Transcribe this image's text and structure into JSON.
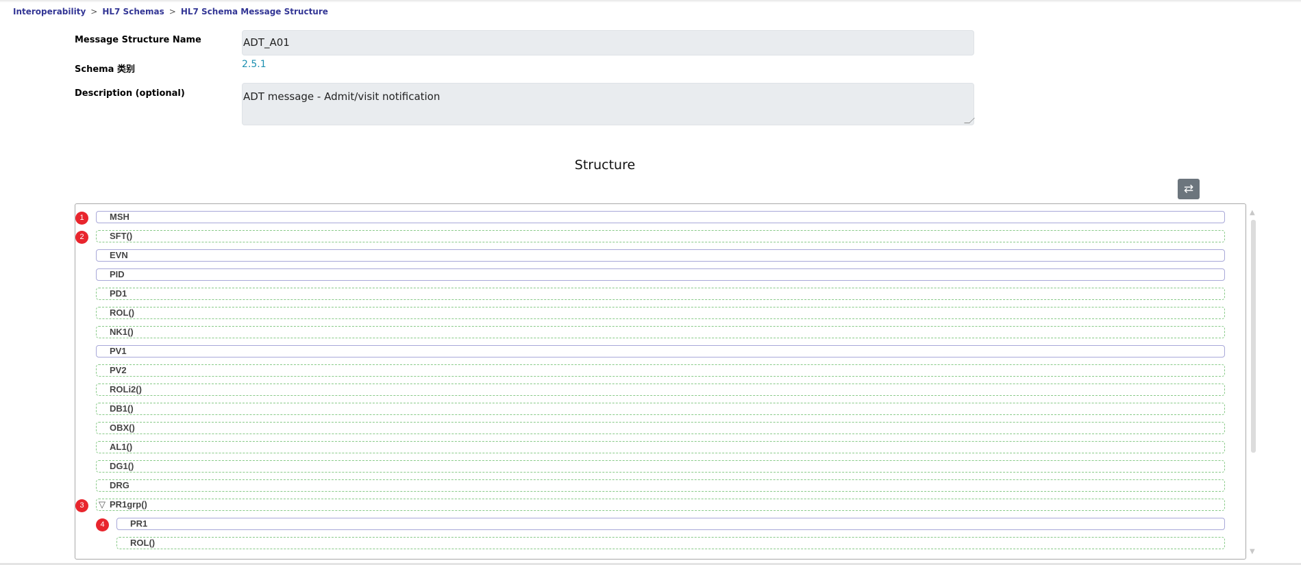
{
  "breadcrumb": {
    "items": [
      "Interoperability",
      "HL7 Schemas",
      "HL7 Schema Message Structure"
    ],
    "separator": ">"
  },
  "form": {
    "name_label": "Message Structure Name",
    "name_value": "ADT_A01",
    "schema_label": "Schema 类别",
    "schema_value": "2.5.1",
    "description_label": "Description (optional)",
    "description_value": "ADT message - Admit/visit notification"
  },
  "structure": {
    "title": "Structure",
    "toggle_icon": "swap-arrows-icon",
    "segments": [
      {
        "label": "MSH",
        "kind": "required",
        "marker": "1"
      },
      {
        "label": "SFT()",
        "kind": "optional",
        "marker": "2"
      },
      {
        "label": "EVN",
        "kind": "required"
      },
      {
        "label": "PID",
        "kind": "required"
      },
      {
        "label": "PD1",
        "kind": "optional"
      },
      {
        "label": "ROL()",
        "kind": "optional"
      },
      {
        "label": "NK1()",
        "kind": "optional"
      },
      {
        "label": "PV1",
        "kind": "required"
      },
      {
        "label": "PV2",
        "kind": "optional"
      },
      {
        "label": "ROLi2()",
        "kind": "optional"
      },
      {
        "label": "DB1()",
        "kind": "optional"
      },
      {
        "label": "OBX()",
        "kind": "optional"
      },
      {
        "label": "AL1()",
        "kind": "optional"
      },
      {
        "label": "DG1()",
        "kind": "optional"
      },
      {
        "label": "DRG",
        "kind": "optional"
      },
      {
        "label": "PR1grp()",
        "kind": "optional",
        "marker": "3",
        "expanded": true
      },
      {
        "label": "PR1",
        "kind": "required",
        "marker": "4",
        "indent": 1
      },
      {
        "label": "ROL()",
        "kind": "optional",
        "indent": 1
      }
    ]
  },
  "colors": {
    "breadcrumb": "#333695",
    "link": "#1b8fb0",
    "required_border": "#a7a7d8",
    "optional_border": "#86c986",
    "marker": "#e8252d",
    "button": "#6c757d"
  }
}
